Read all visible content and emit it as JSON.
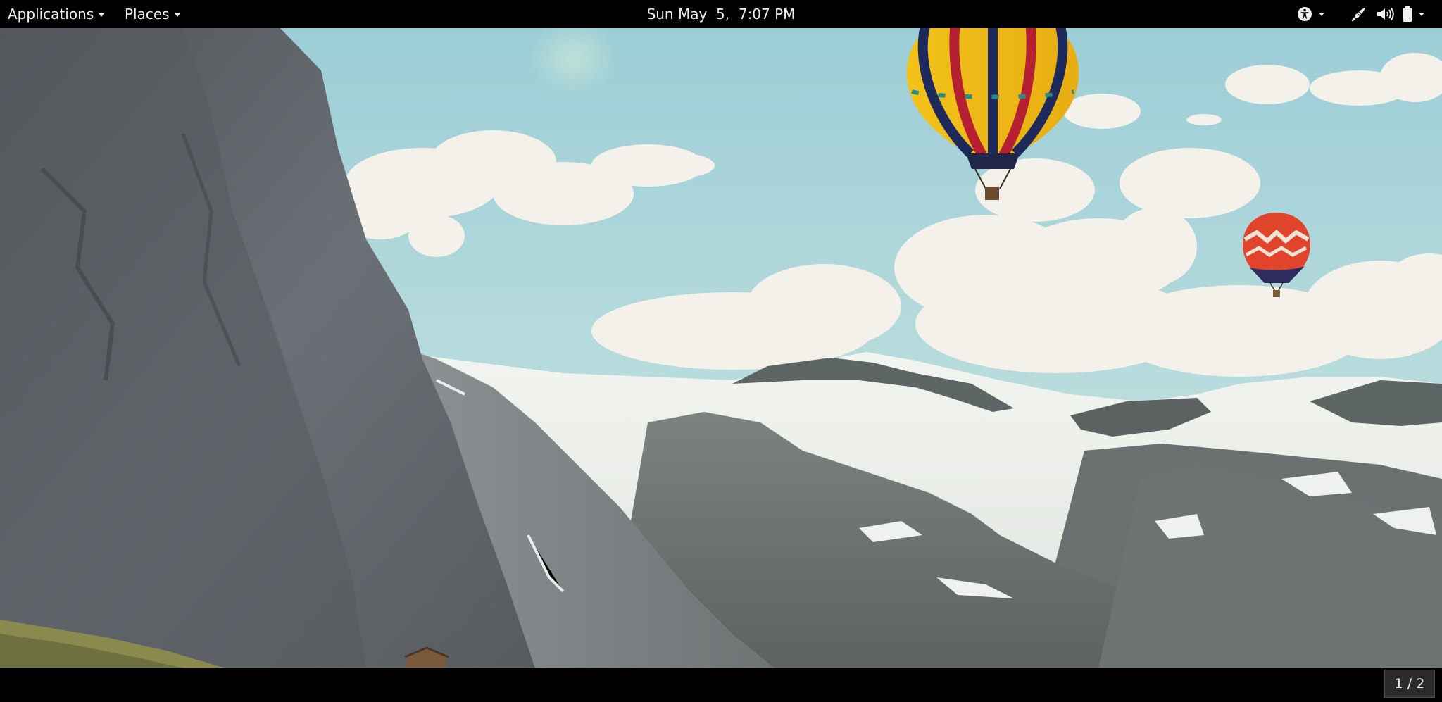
{
  "top_bar": {
    "applications_label": "Applications",
    "places_label": "Places",
    "clock": "Sun May  5,  7:07 PM",
    "icons": [
      "accessibility-icon",
      "network-wired-icon",
      "volume-icon",
      "battery-icon"
    ]
  },
  "wallpaper": {
    "description_icons": [
      "hot-air-balloon-large",
      "hot-air-balloon-small"
    ]
  },
  "bottom_bar": {
    "workspace_indicator": "1 / 2"
  },
  "colors": {
    "panel": "#000000",
    "panel_text": "#eeeeec",
    "sky": "#a9d3d9"
  }
}
